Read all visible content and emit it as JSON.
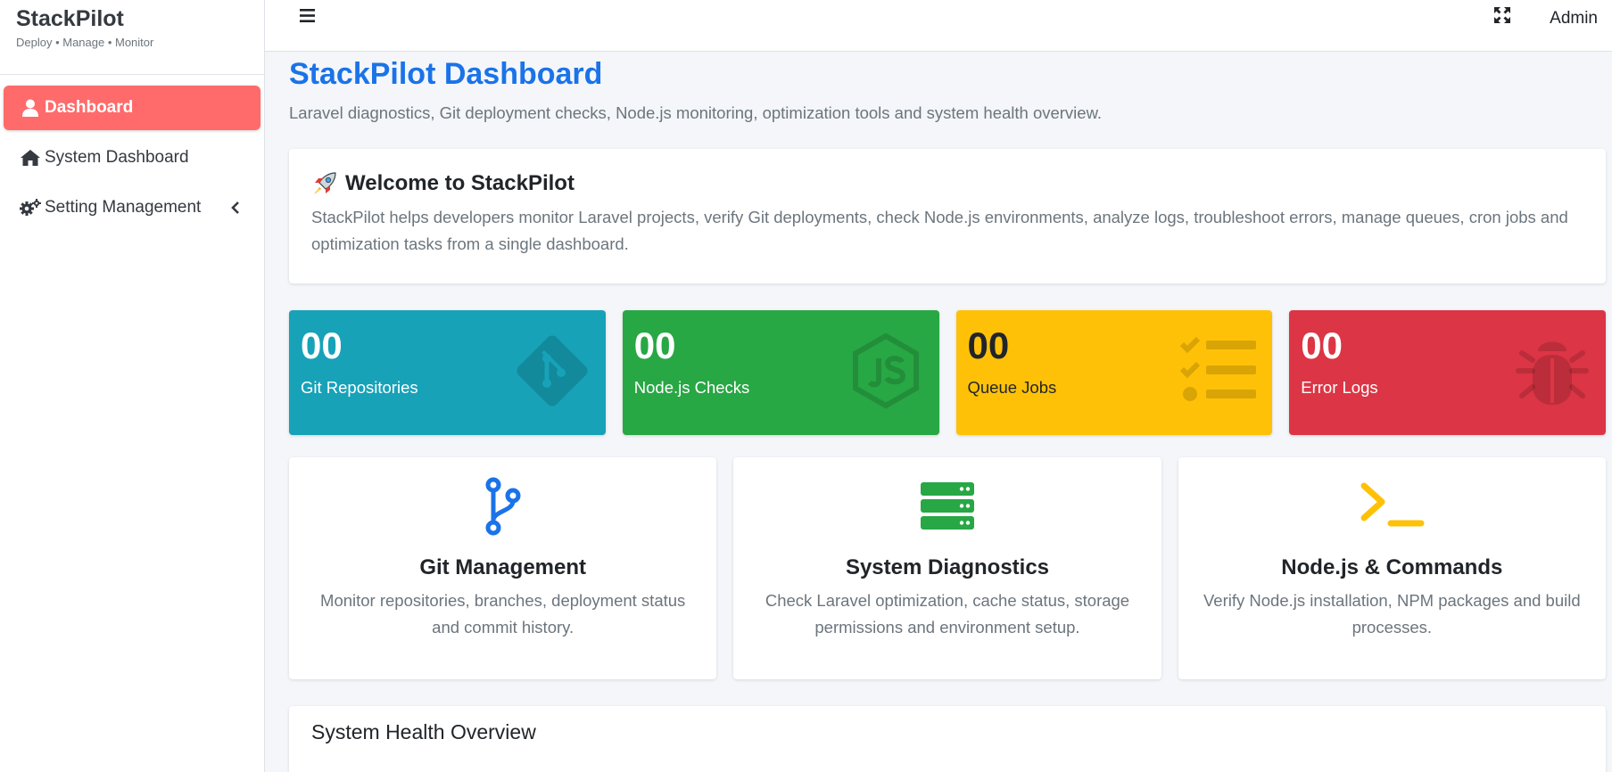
{
  "brand": {
    "title": "StackPilot",
    "tagline": "Deploy • Manage • Monitor"
  },
  "sidebar": {
    "items": [
      {
        "label": "Dashboard",
        "icon": "user-icon",
        "active": true
      },
      {
        "label": "System Dashboard",
        "icon": "home-icon",
        "active": false
      },
      {
        "label": "Setting Management",
        "icon": "cogs-icon",
        "active": false
      }
    ]
  },
  "header": {
    "user": "Admin"
  },
  "page": {
    "title": "StackPilot Dashboard",
    "subtitle": "Laravel diagnostics, Git deployment checks, Node.js monitoring, optimization tools and system health overview."
  },
  "welcome": {
    "title": "Welcome to StackPilot",
    "text": "StackPilot helps developers monitor Laravel projects, verify Git deployments, check Node.js environments, analyze logs, troubleshoot errors, manage queues, cron jobs and optimization tasks from a single dashboard."
  },
  "stats": [
    {
      "value": "00",
      "label": "Git Repositories",
      "color": "#17a2b8",
      "icon": "git-icon"
    },
    {
      "value": "00",
      "label": "Node.js Checks",
      "color": "#28a745",
      "icon": "nodejs-icon"
    },
    {
      "value": "00",
      "label": "Queue Jobs",
      "color": "#ffc107",
      "icon": "tasks-icon"
    },
    {
      "value": "00",
      "label": "Error Logs",
      "color": "#dc3545",
      "icon": "bug-icon"
    }
  ],
  "features": [
    {
      "title": "Git Management",
      "text": "Monitor repositories, branches, deployment status and commit history.",
      "icon": "code-branch-icon",
      "color": "#1a73e8"
    },
    {
      "title": "System Diagnostics",
      "text": "Check Laravel optimization, cache status, storage permissions and environment setup.",
      "icon": "server-icon",
      "color": "#28a745"
    },
    {
      "title": "Node.js & Commands",
      "text": "Verify Node.js installation, NPM packages and build processes.",
      "icon": "terminal-icon",
      "color": "#ffc107"
    }
  ],
  "health": {
    "title": "System Health Overview"
  }
}
